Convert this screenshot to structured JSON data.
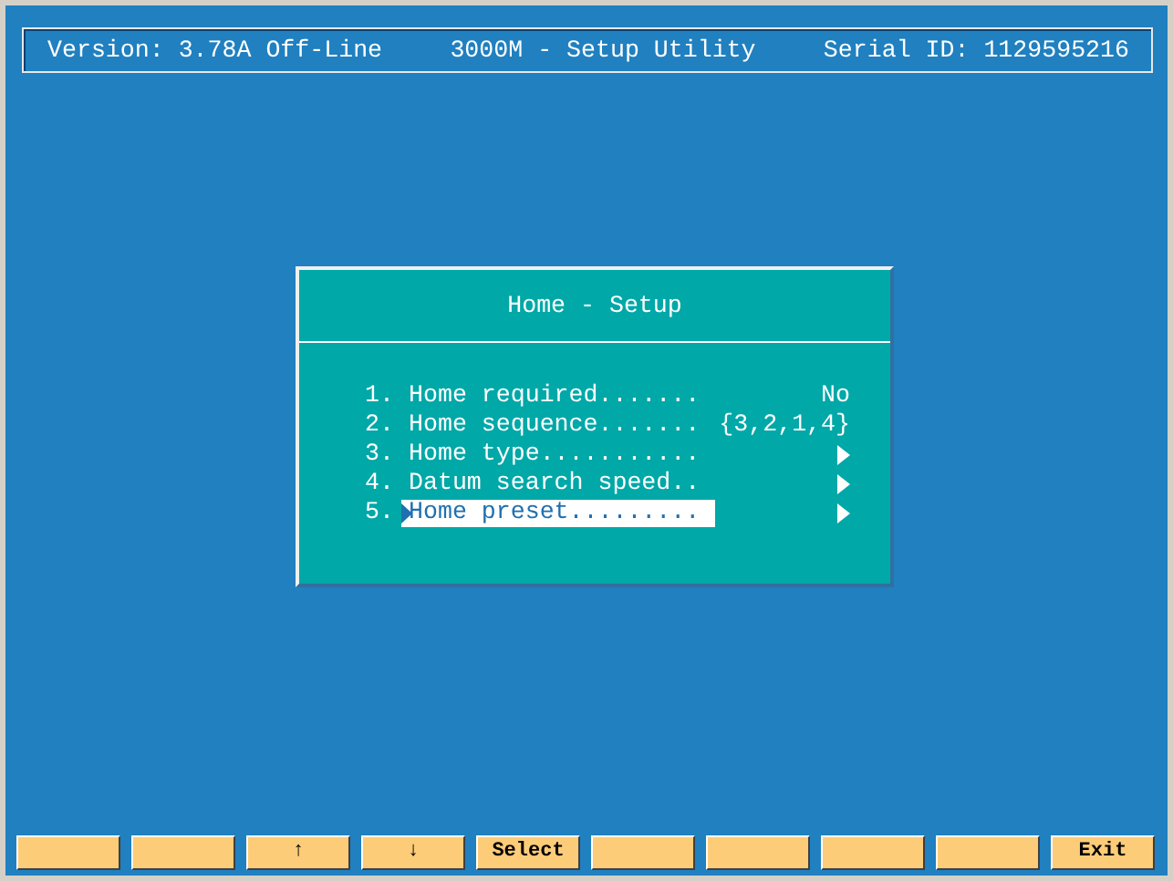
{
  "header": {
    "version": "Version: 3.78A Off-Line",
    "title": "3000M - Setup Utility",
    "serial": "Serial ID: 1129595216"
  },
  "dialog": {
    "title": "Home - Setup",
    "items": [
      {
        "number": "1.",
        "label": "Home required.......",
        "kind": "value",
        "value": "No",
        "selected": false
      },
      {
        "number": "2.",
        "label": "Home sequence.......",
        "kind": "value",
        "value": "{3,2,1,4}",
        "selected": false
      },
      {
        "number": "3.",
        "label": "Home type...........",
        "kind": "submenu",
        "selected": false
      },
      {
        "number": "4.",
        "label": "Datum search speed..",
        "kind": "submenu",
        "selected": false
      },
      {
        "number": "5.",
        "label": "Home preset.........",
        "kind": "submenu",
        "selected": true
      }
    ]
  },
  "function_keys": [
    {
      "kind": "blank"
    },
    {
      "kind": "blank"
    },
    {
      "kind": "labeled",
      "label": "↑"
    },
    {
      "kind": "labeled",
      "label": "↓"
    },
    {
      "kind": "labeled",
      "label": "Select"
    },
    {
      "kind": "blank"
    },
    {
      "kind": "blank"
    },
    {
      "kind": "blank"
    },
    {
      "kind": "blank"
    },
    {
      "kind": "labeled",
      "label": "Exit"
    }
  ]
}
